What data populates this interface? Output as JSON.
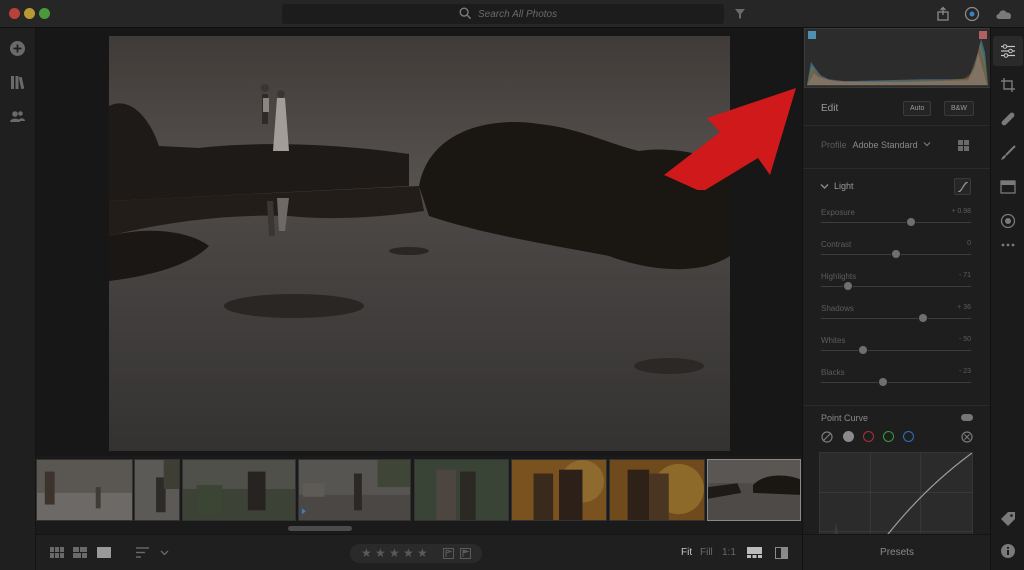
{
  "search": {
    "placeholder": "Search All Photos"
  },
  "edit": {
    "title": "Edit",
    "auto_label": "Auto",
    "bw_label": "B&W",
    "profile_label": "Profile",
    "profile_value": "Adobe Standard",
    "light_label": "Light",
    "sliders": [
      {
        "label": "Exposure",
        "value": "+ 0.98",
        "position": 0.6
      },
      {
        "label": "Contrast",
        "value": "0",
        "position": 0.5
      },
      {
        "label": "Highlights",
        "value": "- 71",
        "position": 0.18
      },
      {
        "label": "Shadows",
        "value": "+ 36",
        "position": 0.68
      },
      {
        "label": "Whites",
        "value": "- 50",
        "position": 0.28
      },
      {
        "label": "Blacks",
        "value": "- 23",
        "position": 0.41
      }
    ],
    "point_curve_label": "Point Curve"
  },
  "bottombar": {
    "fit_label": "Fit",
    "fill_label": "Fill",
    "one_to_one_label": "1:1"
  },
  "presets_label": "Presets",
  "colors": {
    "accent_red": "#d0191a",
    "panel_bg": "#1e1e1e",
    "app_bg": "#1a1a1a"
  }
}
